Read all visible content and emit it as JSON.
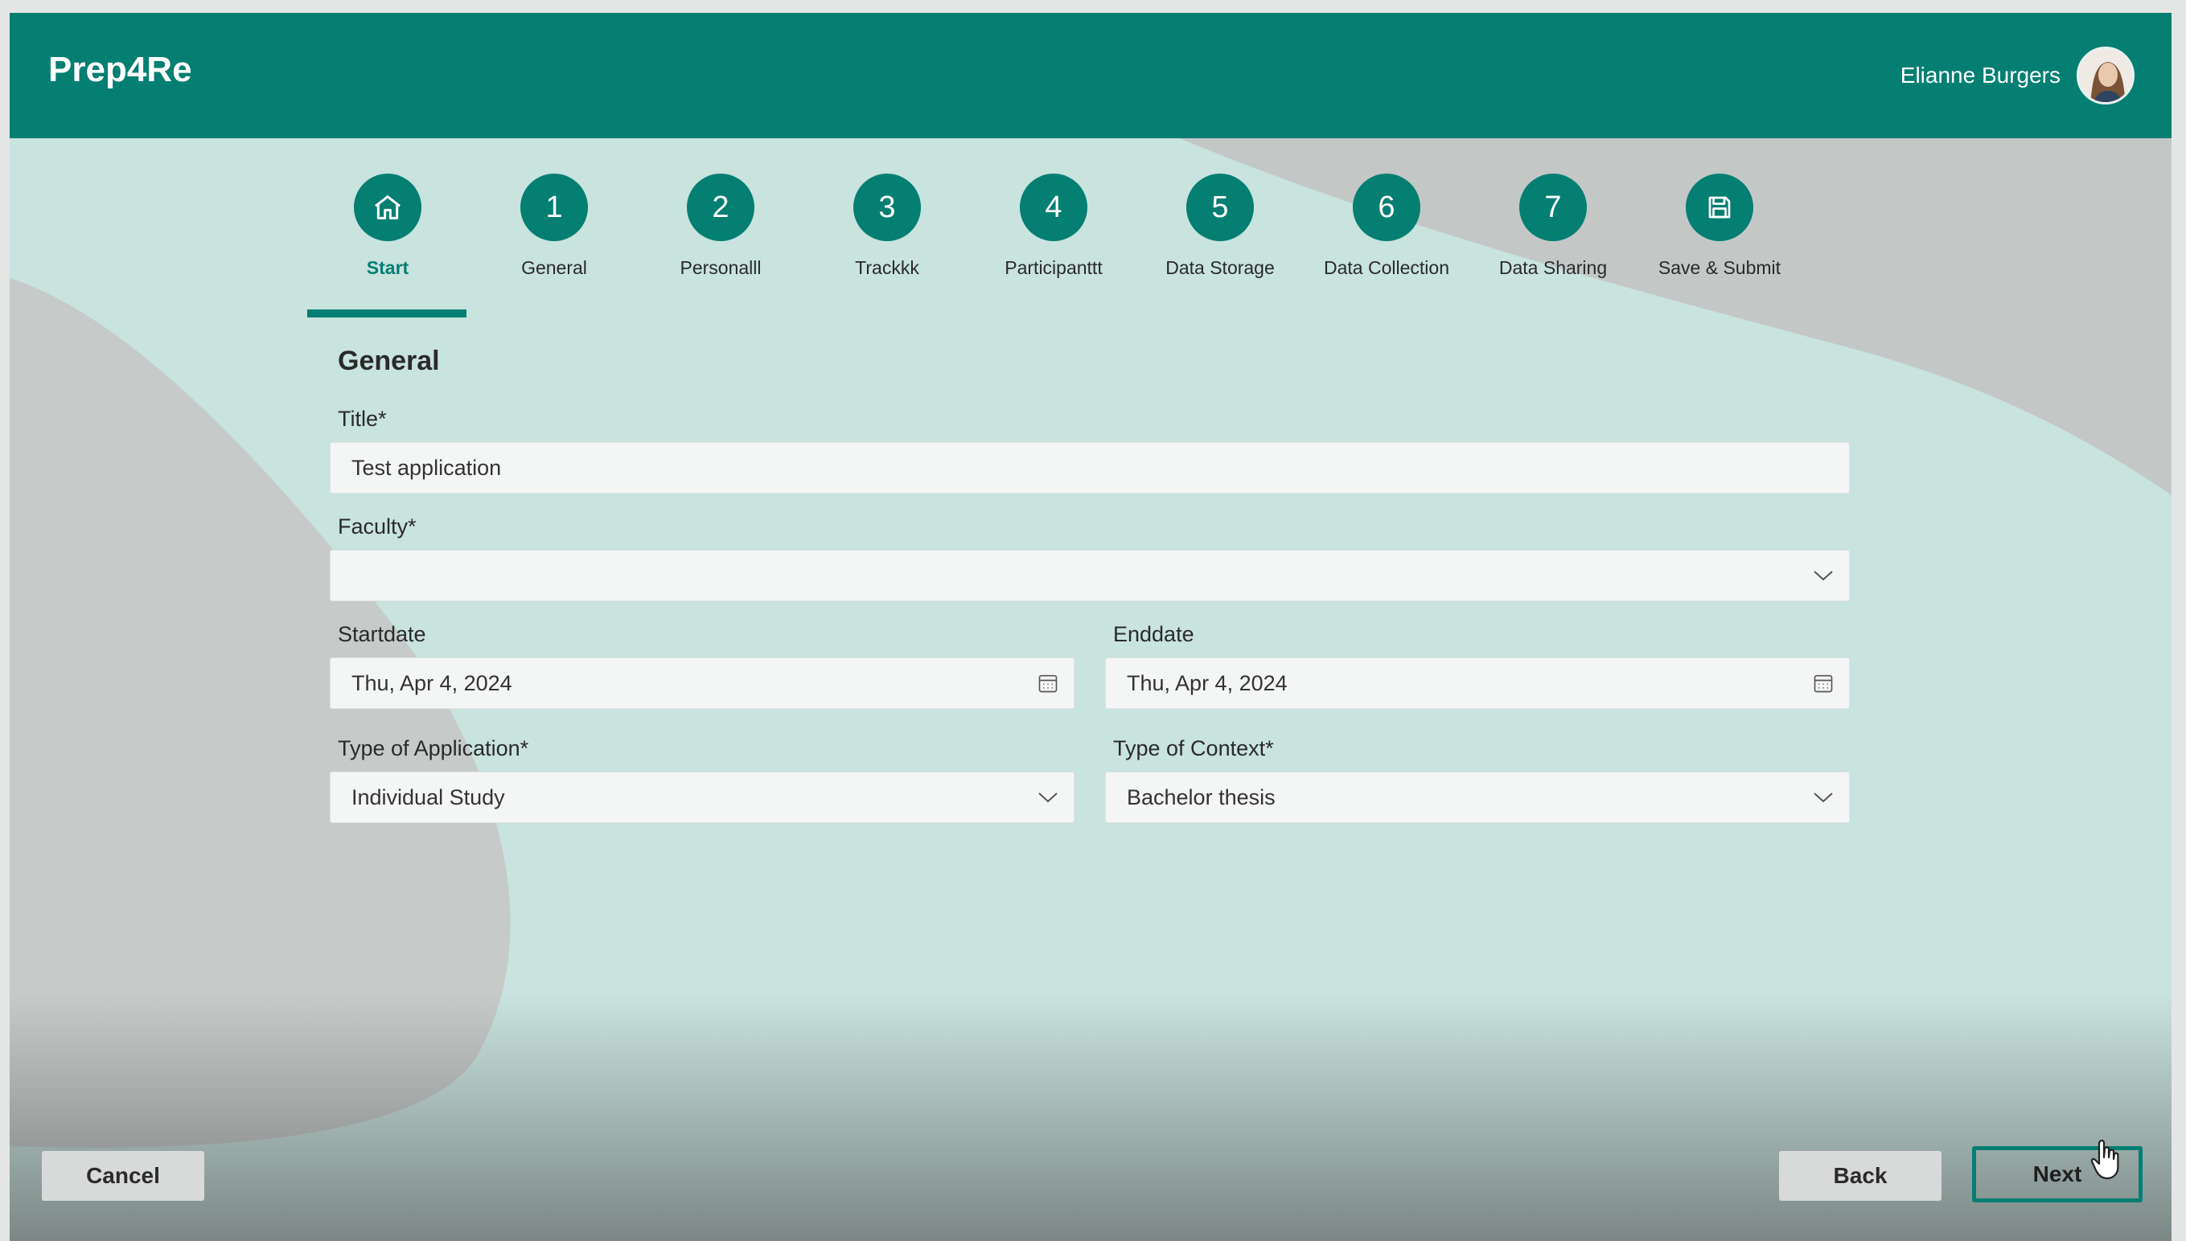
{
  "app": {
    "title": "Prep4Re"
  },
  "user": {
    "name": "Elianne Burgers"
  },
  "steps": [
    {
      "label": "Start",
      "symbol": "home-icon",
      "active": true
    },
    {
      "label": "General",
      "number": "1"
    },
    {
      "label": "Personalll",
      "number": "2"
    },
    {
      "label": "Trackkk",
      "number": "3"
    },
    {
      "label": "Participanttt",
      "number": "4"
    },
    {
      "label": "Data Storage",
      "number": "5"
    },
    {
      "label": "Data Collection",
      "number": "6"
    },
    {
      "label": "Data Sharing",
      "number": "7"
    },
    {
      "label": "Save & Submit",
      "symbol": "save-icon"
    }
  ],
  "form": {
    "section_title": "General",
    "title": {
      "label": "Title*",
      "value": "Test application"
    },
    "faculty": {
      "label": "Faculty*",
      "value": ""
    },
    "startdate": {
      "label": "Startdate",
      "value": "Thu, Apr 4, 2024"
    },
    "enddate": {
      "label": "Enddate",
      "value": "Thu, Apr 4, 2024"
    },
    "type_of_application": {
      "label": "Type of Application*",
      "value": "Individual Study"
    },
    "type_of_context": {
      "label": "Type of Context*",
      "value": "Bachelor thesis"
    }
  },
  "footer": {
    "cancel": "Cancel",
    "back": "Back",
    "next": "Next"
  },
  "colors": {
    "brand": "#047f72",
    "background": "#c9e3df"
  }
}
